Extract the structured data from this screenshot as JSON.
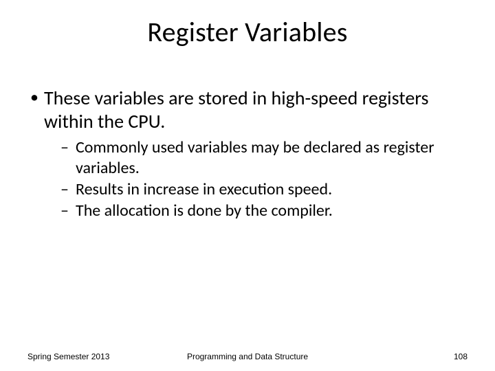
{
  "title": "Register Variables",
  "bullets": {
    "item1": "These variables are stored in high-speed registers within the CPU.",
    "sub1": "Commonly used variables may be declared as register variables.",
    "sub2": "Results in increase in execution speed.",
    "sub3": "The allocation is done by the compiler."
  },
  "footer": {
    "left": "Spring Semester 2013",
    "center": "Programming and Data Structure",
    "right": "108"
  }
}
